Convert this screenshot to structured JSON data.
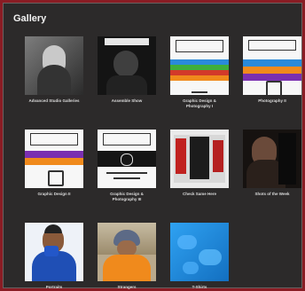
{
  "gallery": {
    "title": "Gallery",
    "items": [
      {
        "caption": "Advanced Studio Galleries"
      },
      {
        "caption": "Assemble Show"
      },
      {
        "caption": "Graphic Design & Photography I"
      },
      {
        "caption": "Photography II"
      },
      {
        "caption": "Graphic Design II"
      },
      {
        "caption": "Graphic Design & Photography III"
      },
      {
        "caption": "Check Same Here"
      },
      {
        "caption": "Shots of the Week"
      },
      {
        "caption": "Portraits"
      },
      {
        "caption": "Strangers"
      },
      {
        "caption": "T-Shirts"
      }
    ]
  },
  "colors": {
    "frame": "#8a1c24",
    "panel": "#2c2a2a",
    "stripe_blue": "#2a8ad9",
    "stripe_purple": "#7a2fb0",
    "stripe_orange": "#f08a1c",
    "stripe_green": "#3fae3a",
    "stripe_red": "#d23a2a"
  }
}
